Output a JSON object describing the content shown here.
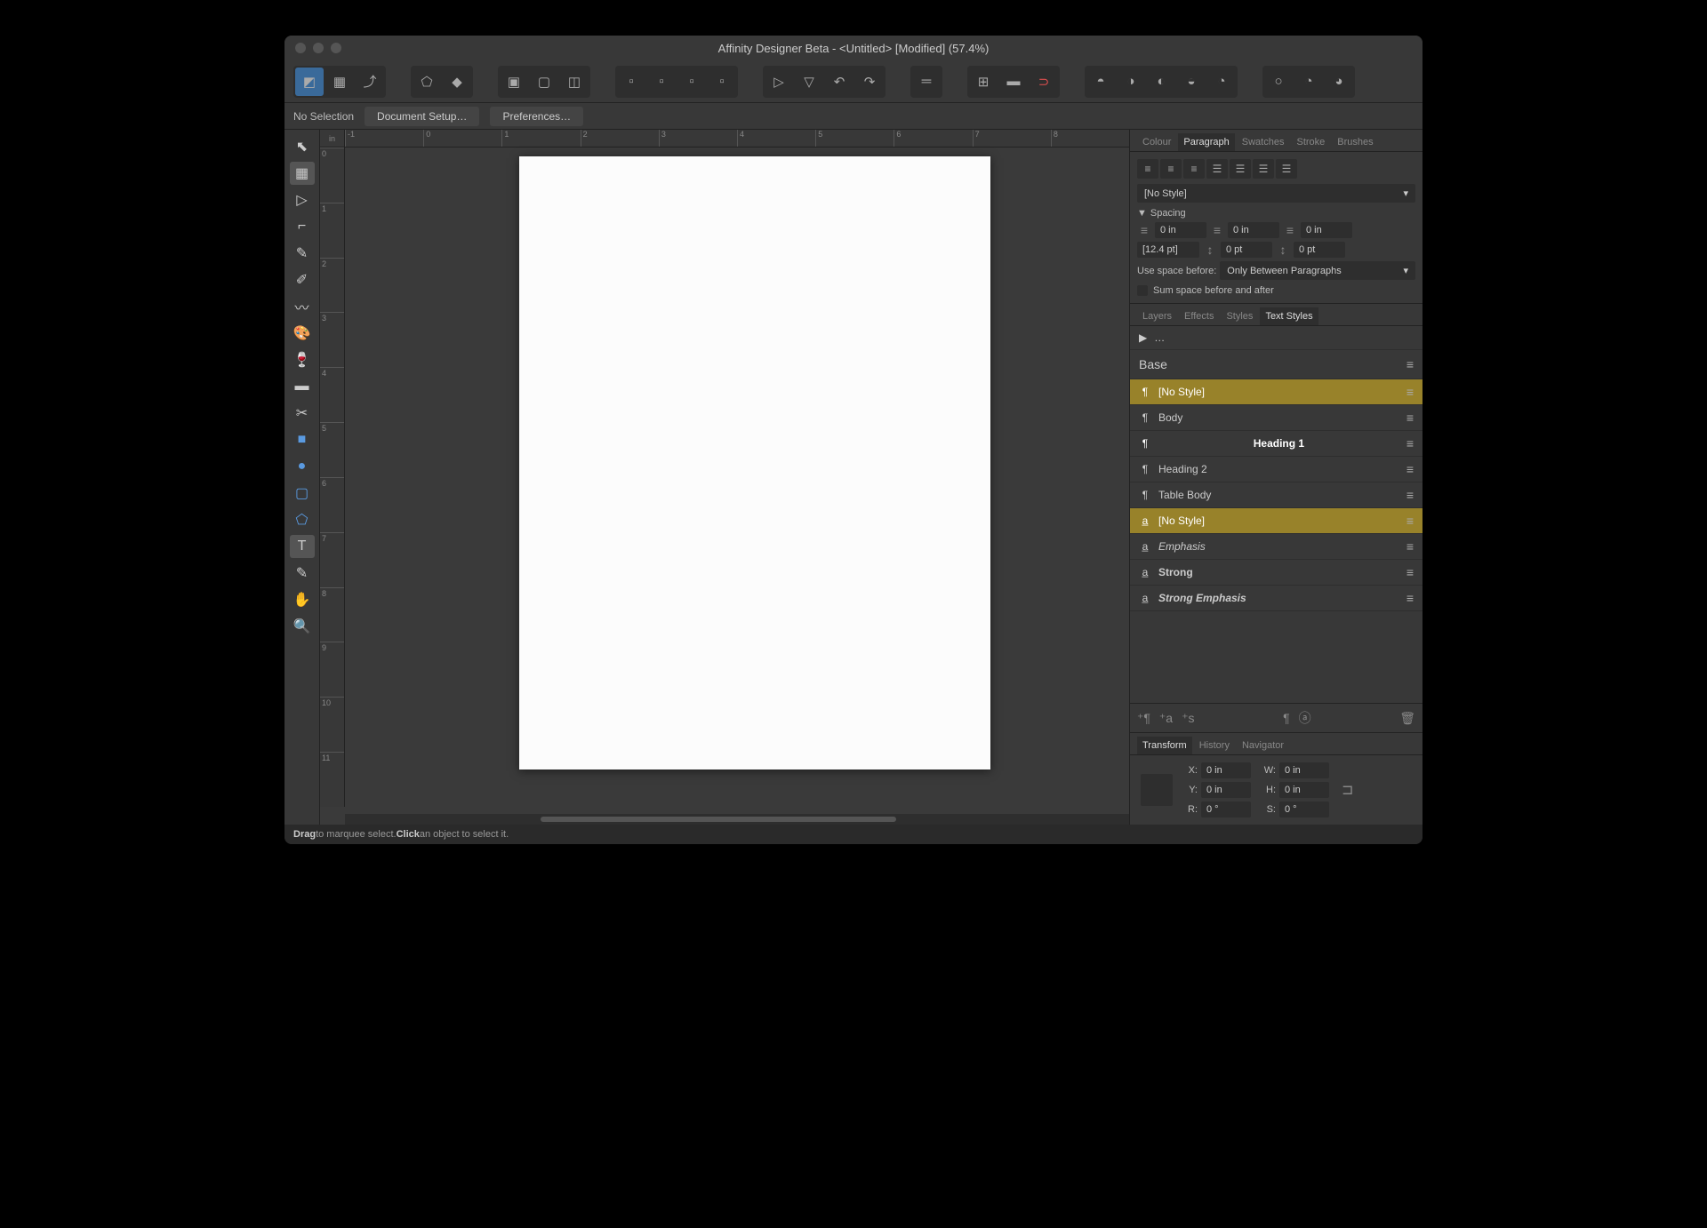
{
  "window": {
    "title": "Affinity Designer Beta - <Untitled> [Modified] (57.4%)"
  },
  "context": {
    "selection": "No Selection",
    "docsetup": "Document Setup…",
    "prefs": "Preferences…"
  },
  "ruler": {
    "unit": "in",
    "h": [
      "-1",
      "0",
      "1",
      "2",
      "3",
      "4",
      "5",
      "6",
      "7",
      "8"
    ],
    "v": [
      "0",
      "1",
      "2",
      "3",
      "4",
      "5",
      "6",
      "7",
      "8",
      "9",
      "10",
      "11"
    ]
  },
  "panel_tabs_top": [
    "Colour",
    "Paragraph",
    "Swatches",
    "Stroke",
    "Brushes"
  ],
  "paragraph": {
    "style_dropdown": "[No Style]",
    "spacing_label": "Spacing",
    "left": "0 in",
    "right": "0 in",
    "first": "0 in",
    "leading": "[12.4 pt]",
    "before": "0 pt",
    "after": "0 pt",
    "use_space_before_label": "Use space before:",
    "use_space_before_value": "Only Between Paragraphs",
    "sum_label": "Sum space before and after"
  },
  "panel_tabs_mid": [
    "Layers",
    "Effects",
    "Styles",
    "Text Styles"
  ],
  "text_styles": {
    "crumb": "…",
    "base": "Base",
    "items": [
      {
        "icon": "¶",
        "name": "[No Style]",
        "gold": true
      },
      {
        "icon": "¶",
        "name": "Body"
      },
      {
        "icon": "¶",
        "name": "Heading 1",
        "selected": true
      },
      {
        "icon": "¶",
        "name": "Heading 2"
      },
      {
        "icon": "¶",
        "name": "Table Body"
      },
      {
        "icon": "a̲",
        "name": "[No Style]",
        "gold": true
      },
      {
        "icon": "a̲",
        "name": "Emphasis",
        "italic": true
      },
      {
        "icon": "a̲",
        "name": "Strong",
        "bold": true
      },
      {
        "icon": "a̲",
        "name": "Strong Emphasis",
        "bold": true,
        "italic": true
      }
    ]
  },
  "panel_tabs_bottom": [
    "Transform",
    "History",
    "Navigator"
  ],
  "transform": {
    "x_label": "X:",
    "x": "0 in",
    "y_label": "Y:",
    "y": "0 in",
    "w_label": "W:",
    "w": "0 in",
    "h_label": "H:",
    "h": "0 in",
    "r_label": "R:",
    "r": "0 °",
    "s_label": "S:",
    "s": "0 °"
  },
  "status": {
    "drag": "Drag",
    "drag_txt": " to marquee select. ",
    "click": "Click",
    "click_txt": " an object to select it."
  }
}
